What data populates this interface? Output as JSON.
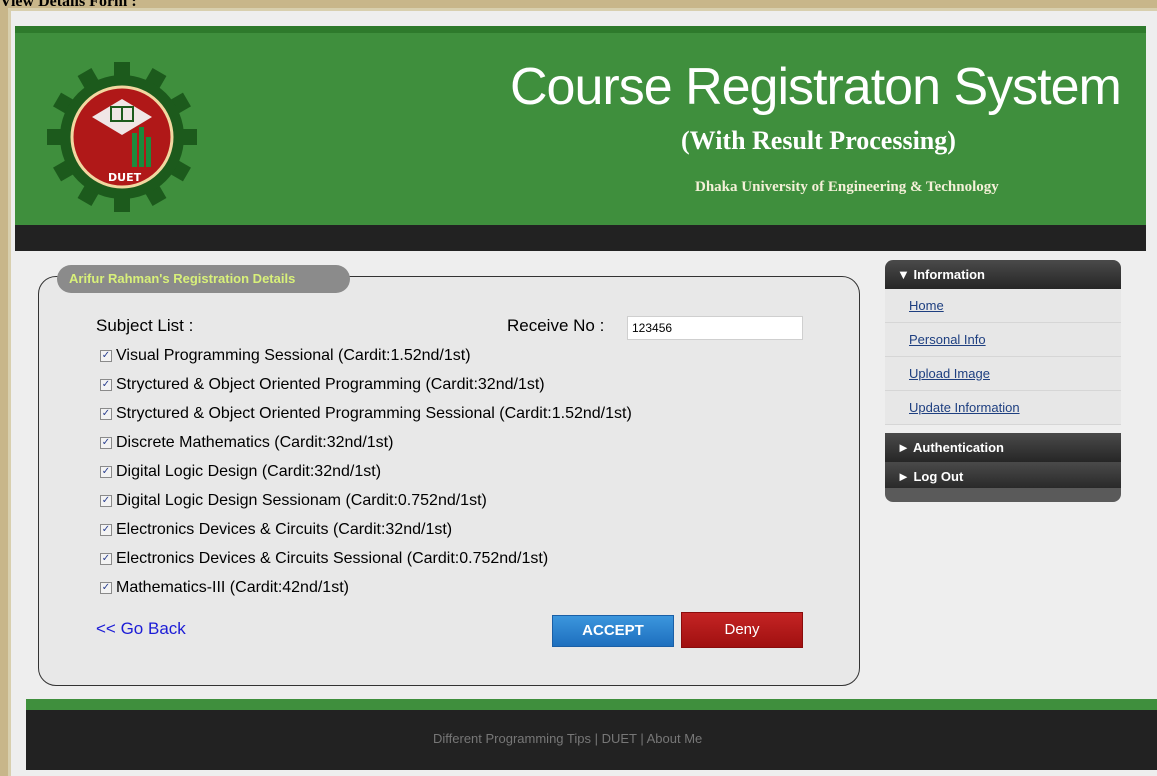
{
  "caption": "View Details Form :",
  "header": {
    "title": "Course Registraton System",
    "subtitle": "(With Result Processing)",
    "university": "Dhaka University of Engineering & Technology",
    "logo_text": "DUET"
  },
  "details": {
    "legend": "Arifur Rahman's Registration Details",
    "subject_list_label": "Subject List :",
    "receive_label": "Receive No :",
    "receive_value": "123456",
    "subjects": [
      {
        "label": "Visual Programming Sessional (Cardit:1.52nd/1st)",
        "checked": true
      },
      {
        "label": "Stryctured & Object Oriented Programming (Cardit:32nd/1st)",
        "checked": true
      },
      {
        "label": "Stryctured & Object Oriented Programming Sessional (Cardit:1.52nd/1st)",
        "checked": true
      },
      {
        "label": "Discrete Mathematics (Cardit:32nd/1st)",
        "checked": true
      },
      {
        "label": "Digital Logic Design (Cardit:32nd/1st)",
        "checked": true
      },
      {
        "label": "Digital Logic Design Sessionam (Cardit:0.752nd/1st)",
        "checked": true
      },
      {
        "label": "Electronics Devices & Circuits (Cardit:32nd/1st)",
        "checked": true
      },
      {
        "label": "Electronics Devices & Circuits Sessional (Cardit:0.752nd/1st)",
        "checked": true
      },
      {
        "label": "Mathematics-III (Cardit:42nd/1st)",
        "checked": true
      }
    ],
    "go_back": "<< Go Back",
    "accept": "ACCEPT",
    "deny": "Deny"
  },
  "sidebar": {
    "information": "▼ Information",
    "links": [
      "Home",
      "Personal Info",
      "Upload Image",
      "Update Information"
    ],
    "authentication": "► Authentication",
    "logout": "► Log Out"
  },
  "footer": {
    "text": "Different Programming Tips | DUET | About Me"
  },
  "colors": {
    "header_green": "#3f8f3d",
    "dark_bar": "#222222",
    "accept_blue": "#2a7fcf",
    "deny_red": "#b01a1a",
    "legend_text": "#d8f07a"
  }
}
